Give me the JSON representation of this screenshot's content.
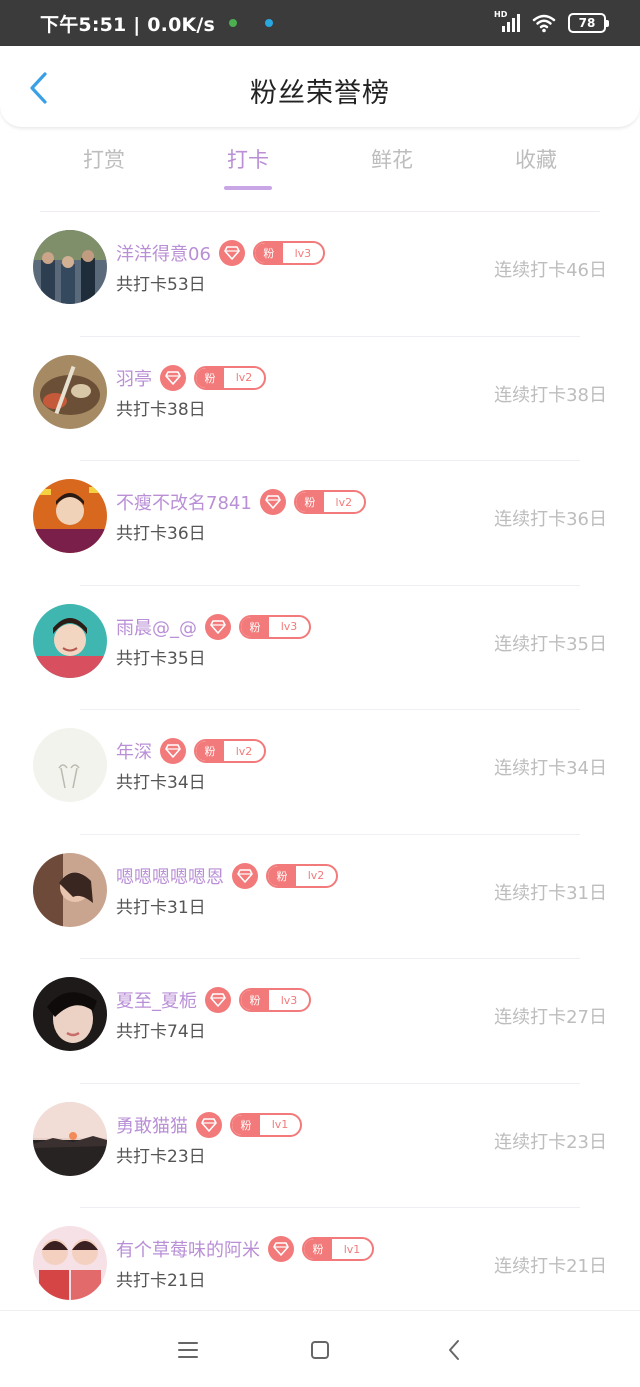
{
  "status_bar": {
    "time": "下午5:51 | 0.0K/s",
    "network_type": "HD",
    "battery": "78",
    "icons": [
      "notification-dot-icon",
      "signal-icon",
      "wifi-icon",
      "battery-icon"
    ]
  },
  "header": {
    "title": "粉丝荣誉榜",
    "back_icon": "chevron-left-icon"
  },
  "tabs": [
    {
      "label": "打赏",
      "active": false
    },
    {
      "label": "打卡",
      "active": true
    },
    {
      "label": "鲜花",
      "active": false
    },
    {
      "label": "收藏",
      "active": false
    }
  ],
  "ranking": [
    {
      "name": "洋洋得意06",
      "total": "共打卡53日",
      "streak": "连续打卡46日",
      "fan_label": "粉",
      "level": "lv3"
    },
    {
      "name": "羽亭",
      "total": "共打卡38日",
      "streak": "连续打卡38日",
      "fan_label": "粉",
      "level": "lv2"
    },
    {
      "name": "不瘦不改名7841",
      "total": "共打卡36日",
      "streak": "连续打卡36日",
      "fan_label": "粉",
      "level": "lv2"
    },
    {
      "name": "雨晨@_@",
      "total": "共打卡35日",
      "streak": "连续打卡35日",
      "fan_label": "粉",
      "level": "lv3"
    },
    {
      "name": "年深",
      "total": "共打卡34日",
      "streak": "连续打卡34日",
      "fan_label": "粉",
      "level": "lv2"
    },
    {
      "name": "嗯嗯嗯嗯嗯恩",
      "total": "共打卡31日",
      "streak": "连续打卡31日",
      "fan_label": "粉",
      "level": "lv2"
    },
    {
      "name": "夏至_夏栀",
      "total": "共打卡74日",
      "streak": "连续打卡27日",
      "fan_label": "粉",
      "level": "lv3"
    },
    {
      "name": "勇敢猫猫",
      "total": "共打卡23日",
      "streak": "连续打卡23日",
      "fan_label": "粉",
      "level": "lv1"
    },
    {
      "name": "有个草莓味的阿米",
      "total": "共打卡21日",
      "streak": "连续打卡21日",
      "fan_label": "粉",
      "level": "lv1"
    }
  ],
  "nav_bar": {
    "icons": [
      "menu-icon",
      "home-square-icon",
      "back-arrow-icon"
    ]
  },
  "colors": {
    "accent_purple": "#b98fd6",
    "badge_red": "#f27a7a",
    "muted_gray": "#bdbdbd"
  }
}
